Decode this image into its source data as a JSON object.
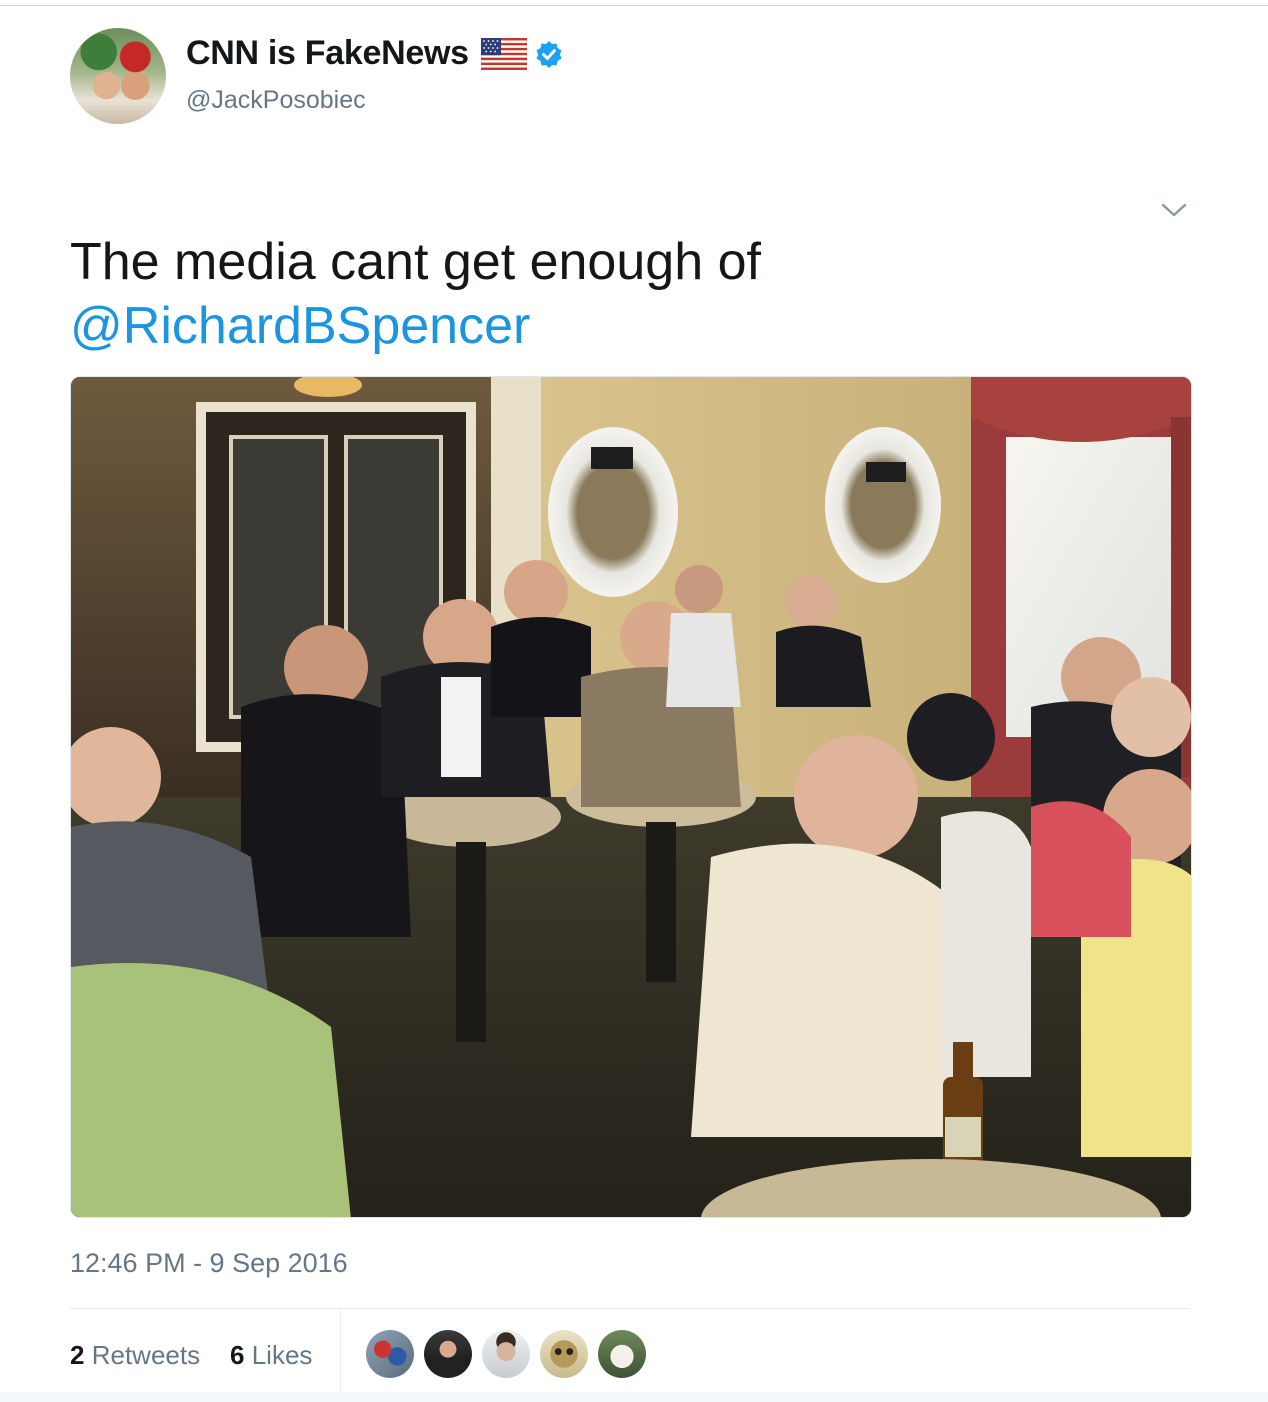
{
  "tweet": {
    "display_name": "CNN is FakeNews",
    "handle": "@JackPosobiec",
    "text": "The media cant get enough of ",
    "mention": "@RichardBSpencer",
    "timestamp": "12:46 PM - 9 Sep 2016"
  },
  "icons": {
    "flag": "us-flag-icon",
    "verified": "verified-badge-icon",
    "menu": "chevron-down-icon"
  },
  "stats": {
    "retweets_count": "2",
    "retweets_label": "Retweets",
    "likes_count": "6",
    "likes_label": "Likes"
  },
  "colors": {
    "text": "#14171a",
    "secondary": "#657786",
    "link": "#1b95e0",
    "verified": "#1da1f2"
  }
}
